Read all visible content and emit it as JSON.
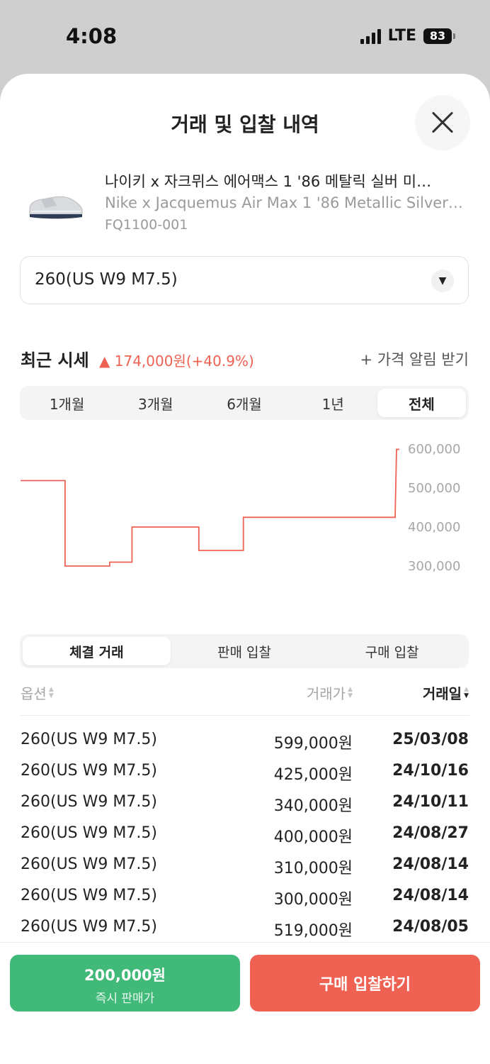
{
  "status_bar": {
    "time": "4:08",
    "network": "LTE",
    "battery": "83"
  },
  "header": {
    "title": "거래 및 입찰 내역"
  },
  "product": {
    "name_ko": "나이키 x 자크뮈스 에어맥스 1 '86 메탈릭 실버 미…",
    "name_en": "Nike x Jacquemus Air Max 1 '86 Metallic Silver…",
    "model": "FQ1100-001"
  },
  "size_select": {
    "value": "260(US W9 M7.5)",
    "arrow": "▼"
  },
  "market": {
    "title": "최근 시세",
    "change": "▲ 174,000원(+40.9%)",
    "alert": "+ 가격 알림 받기"
  },
  "period_tabs": [
    "1개월",
    "3개월",
    "6개월",
    "1년",
    "전체"
  ],
  "chart_data": {
    "type": "line",
    "step": true,
    "y_ticks": [
      "600,000",
      "500,000",
      "400,000",
      "300,000"
    ],
    "ylim": [
      300000,
      600000
    ],
    "color": "#ef6253",
    "series": [
      {
        "values": [
          519000,
          519000,
          300000,
          300000,
          310000,
          400000,
          400000,
          400000,
          340000,
          340000,
          425000,
          425000,
          425000,
          425000,
          425000,
          425000,
          425000,
          599000
        ]
      }
    ]
  },
  "table_tabs": [
    "체결 거래",
    "판매 입찰",
    "구매 입찰"
  ],
  "table": {
    "headers": {
      "option": "옵션",
      "price": "거래가",
      "date": "거래일"
    },
    "rows": [
      {
        "option": "260(US W9 M7.5)",
        "price": "599,000원",
        "date": "25/03/08"
      },
      {
        "option": "260(US W9 M7.5)",
        "price": "425,000원",
        "date": "24/10/16"
      },
      {
        "option": "260(US W9 M7.5)",
        "price": "340,000원",
        "date": "24/10/11"
      },
      {
        "option": "260(US W9 M7.5)",
        "price": "400,000원",
        "date": "24/08/27"
      },
      {
        "option": "260(US W9 M7.5)",
        "price": "310,000원",
        "date": "24/08/14"
      },
      {
        "option": "260(US W9 M7.5)",
        "price": "300,000원",
        "date": "24/08/14"
      },
      {
        "option": "260(US W9 M7.5)",
        "price": "519,000원",
        "date": "24/08/05"
      }
    ]
  },
  "actions": {
    "sell_price": "200,000원",
    "sell_label": "즉시 판매가",
    "buy_label": "구매 입찰하기"
  },
  "colors": {
    "buy": "#ef6253",
    "sell": "#41b979"
  }
}
